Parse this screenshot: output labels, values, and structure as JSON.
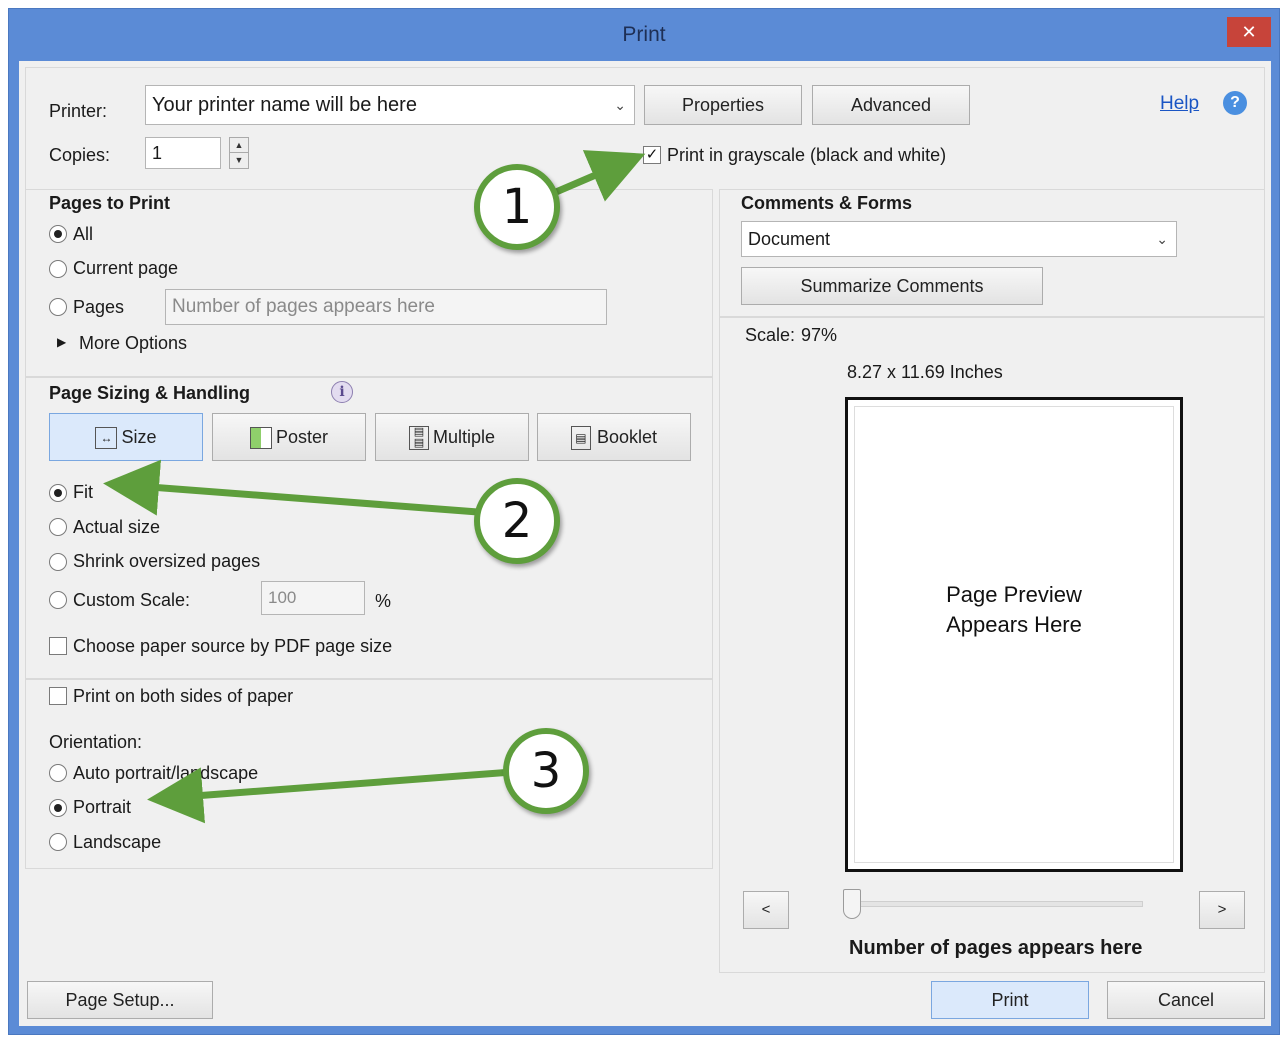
{
  "window": {
    "title": "Print",
    "close_glyph": "✕"
  },
  "printer": {
    "label": "Printer:",
    "value": "Your printer name will be here",
    "properties_label": "Properties",
    "advanced_label": "Advanced"
  },
  "help": {
    "label": "Help",
    "icon": "help-icon"
  },
  "copies": {
    "label": "Copies:",
    "value": "1"
  },
  "grayscale": {
    "label": "Print in grayscale (black and white)",
    "checked": true
  },
  "pages_to_print": {
    "title": "Pages to Print",
    "all_label": "All",
    "current_label": "Current page",
    "pages_label": "Pages",
    "pages_placeholder": "Number of pages appears here",
    "more_options_label": "More Options"
  },
  "sizing": {
    "title": "Page Sizing & Handling",
    "tabs": [
      {
        "label": "Size",
        "icon": "size-icon",
        "selected": true
      },
      {
        "label": "Poster",
        "icon": "poster-icon",
        "selected": false
      },
      {
        "label": "Multiple",
        "icon": "multiple-icon",
        "selected": false
      },
      {
        "label": "Booklet",
        "icon": "booklet-icon",
        "selected": false
      }
    ],
    "fit_label": "Fit",
    "actual_label": "Actual size",
    "shrink_label": "Shrink oversized pages",
    "custom_label": "Custom Scale:",
    "custom_value": "100",
    "custom_unit": "%",
    "paper_source_label": "Choose paper source by PDF page size"
  },
  "duplex": {
    "label": "Print on both sides of paper"
  },
  "orientation": {
    "title": "Orientation:",
    "auto_label": "Auto portrait/landscape",
    "portrait_label": "Portrait",
    "landscape_label": "Landscape"
  },
  "comments_forms": {
    "title": "Comments & Forms",
    "value": "Document",
    "summarize_label": "Summarize Comments"
  },
  "preview": {
    "scale_label": "Scale:",
    "scale_value": "97%",
    "page_size": "8.27 x 11.69 Inches",
    "text_line1": "Page Preview",
    "text_line2": "Appears Here",
    "prev_label": "<",
    "next_label": ">",
    "page_count": "Number of pages appears here"
  },
  "footer": {
    "page_setup_label": "Page Setup...",
    "print_label": "Print",
    "cancel_label": "Cancel"
  },
  "callouts": [
    "1",
    "2",
    "3"
  ],
  "colors": {
    "titlebar": "#5b8bd6",
    "close": "#c7443a",
    "callout_border": "#5e9e3c",
    "link": "#1a55c4"
  }
}
